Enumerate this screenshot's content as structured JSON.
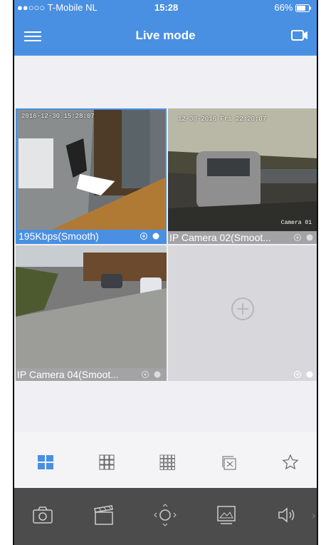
{
  "status": {
    "carrier": "●●○○○ T-Mobile NL",
    "time": "15:28",
    "battery": "66%"
  },
  "header": {
    "title": "Live mode"
  },
  "cameras": [
    {
      "osd_time": "2016-12-30 15:28:07",
      "label": "195Kbps(Smooth)",
      "selected": true
    },
    {
      "osd_time": "12-30-2016 Fri 22:20:07",
      "osd_name": "Camera 01",
      "label": "IP Camera 02(Smoot..."
    },
    {
      "label": "IP Camera 04(Smoot..."
    }
  ],
  "icons": {
    "layout": [
      "grid-2x2-icon",
      "grid-3x3-icon",
      "grid-4x4-icon",
      "close-window-icon",
      "star-icon"
    ],
    "toolbar": [
      "camera-icon",
      "clapperboard-icon",
      "ptz-icon",
      "image-quality-icon",
      "speaker-icon"
    ]
  },
  "colors": {
    "accent": "#4a90e2",
    "toolbar": "#4c4c4c"
  }
}
